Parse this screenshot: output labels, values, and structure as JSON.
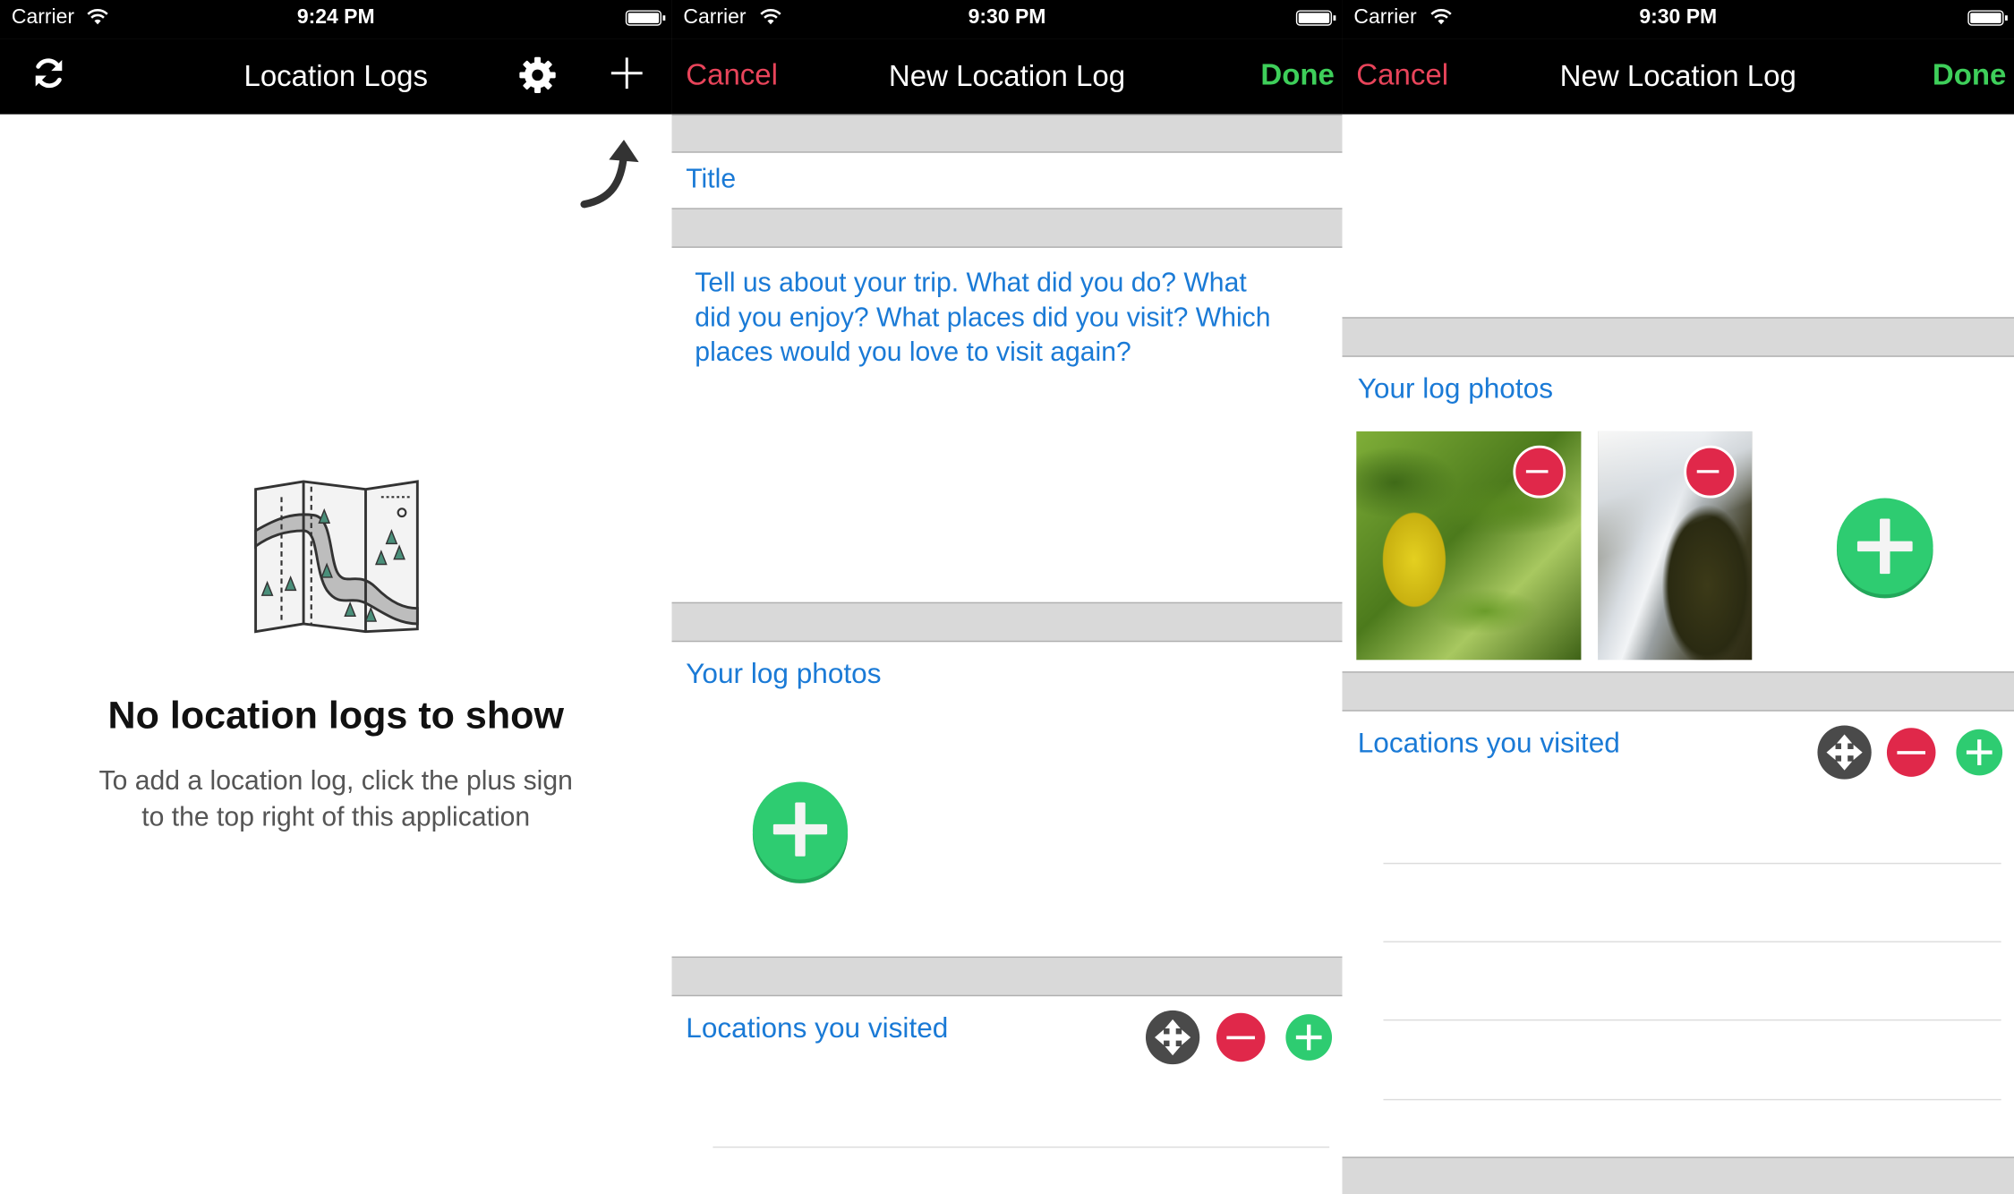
{
  "status_bar": {
    "panel1": {
      "carrier": "Carrier",
      "time": "9:24 PM"
    },
    "panel2": {
      "carrier": "Carrier",
      "time": "9:30 PM"
    },
    "panel3": {
      "carrier": "Carrier",
      "time": "9:30 PM"
    }
  },
  "panel1": {
    "nav": {
      "title": "Location Logs",
      "refresh_icon": "refresh-icon",
      "settings_icon": "gear-icon",
      "add_icon": "plus-icon"
    },
    "empty_state": {
      "icon": "map-icon",
      "title": "No location logs to show",
      "message_line1": "To add a location log, click the plus sign",
      "message_line2": "to the top right of this application"
    }
  },
  "panel2": {
    "nav": {
      "cancel_label": "Cancel",
      "title": "New Location Log",
      "done_label": "Done"
    },
    "title_placeholder": "Title",
    "description_placeholder": "Tell us about your trip. What did you do? What did you enjoy? What places did you visit? Which places would you love to visit again?",
    "description_lines": [
      "Tell us about your trip. What did you do? What",
      "did you enjoy? What places did you visit? Which",
      "places would you love to visit again?"
    ],
    "photos_label": "Your log photos",
    "locations_label": "Locations you visited"
  },
  "panel3": {
    "nav": {
      "cancel_label": "Cancel",
      "title": "New Location Log",
      "done_label": "Done"
    },
    "photos_label": "Your log photos",
    "locations_label": "Locations you visited"
  },
  "colors": {
    "cancel": "#e8445a",
    "done": "#3ecf5a",
    "label_blue": "#1a7ad6",
    "nav_background": "#000000",
    "add_green": "#2ecc71",
    "remove_red": "#e0284a",
    "move_gray": "#4a4a4a"
  }
}
